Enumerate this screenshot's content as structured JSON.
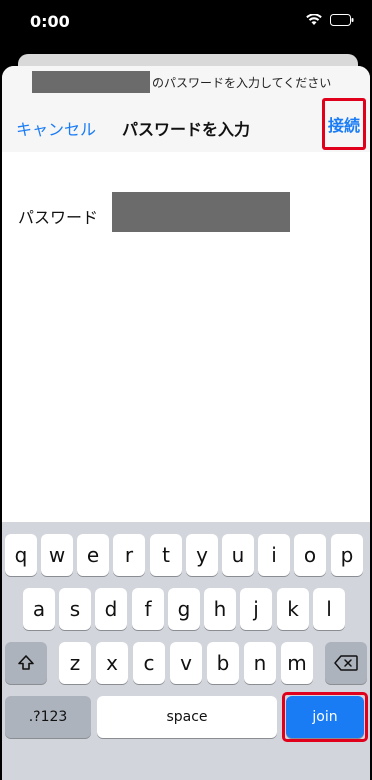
{
  "status": {
    "time": "0:00"
  },
  "header": {
    "network_suffix": "のパスワードを入力してください",
    "cancel": "キャンセル",
    "title": "パスワードを入力",
    "connect": "接続"
  },
  "form": {
    "password_label": "パスワード"
  },
  "keyboard": {
    "row1": [
      "q",
      "w",
      "e",
      "r",
      "t",
      "y",
      "u",
      "i",
      "o",
      "p"
    ],
    "row2": [
      "a",
      "s",
      "d",
      "f",
      "g",
      "h",
      "j",
      "k",
      "l"
    ],
    "row3": [
      "z",
      "x",
      "c",
      "v",
      "b",
      "n",
      "m"
    ],
    "numbers_label": ".?123",
    "space_label": "space",
    "join_label": "join"
  },
  "colors": {
    "accent": "#1a7cf5",
    "highlight": "#e0001b",
    "keyboard_bg": "#d2d5db"
  }
}
